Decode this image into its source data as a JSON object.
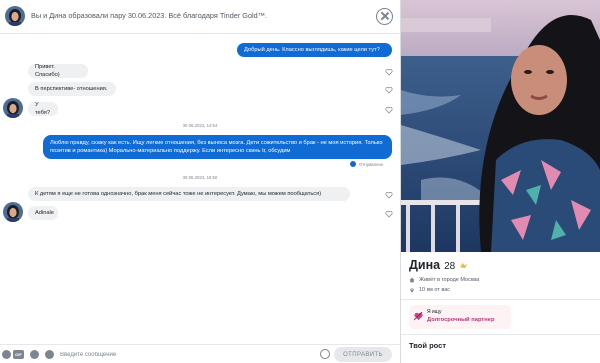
{
  "header": {
    "title": "Вы и Дина образовали пару 30.06.2023. Всё благодаря Tinder Gold™."
  },
  "messages": {
    "m1": "Добрый день. Классно выглядишь, какие цели тут?",
    "m2": "Привет. Спасибо)",
    "m3": "В перспективе- отношения.",
    "m4": "У тебя?",
    "stamp1": "30.06.2023, 14:54",
    "m5": "Люблю правду, скажу как есть. Ищу легкие отношения, без выноса мозга. Дети сожительство и брак - не моя история. Только позитив и романтика) Морально-материально поддержу. Если интересно скинь tг, обсудим",
    "sent_status": "Отправлено",
    "stamp2": "30.06.2023, 15:50",
    "m6": "К детям я еще не готова однозначно, брак меня сейчас тоже не интересует. Думаю, мы можем пообщаться)",
    "m7": "Adinale"
  },
  "composer": {
    "gif_label": "GIF",
    "placeholder": "Введите сообщение",
    "send_label": "ОТПРАВИТЬ"
  },
  "profile": {
    "name": "Дина",
    "age": "28",
    "city": "Живёт в городе Москва",
    "distance": "10 км от вас",
    "goal_title": "Я ищу",
    "goal_value": "Долгосрочный партнер",
    "section_height": "Твой рост"
  },
  "colors": {
    "accent": "#106bd5",
    "incoming": "#eef0f2",
    "goal_bg": "#fdf2f4",
    "goal_text": "#b43a77"
  },
  "icons": {
    "close": "close-icon",
    "like": "heart-icon",
    "verified": "gold-badge-icon",
    "home": "home-icon",
    "location": "location-pin-icon",
    "goal": "heart-arrow-icon"
  }
}
